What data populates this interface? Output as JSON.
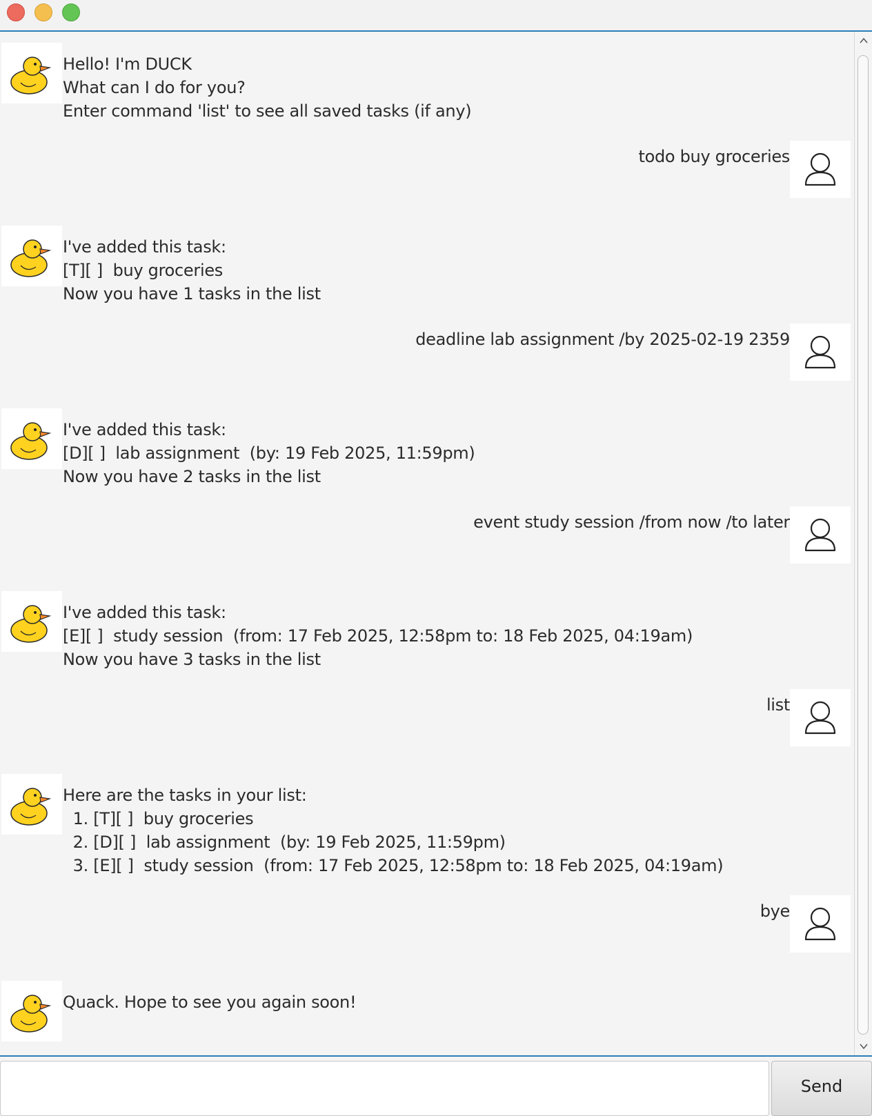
{
  "window": {
    "controls": [
      "close",
      "minimize",
      "zoom"
    ]
  },
  "messages": [
    {
      "sender": "bot",
      "avatar_icon": "duck-icon",
      "text": "Hello! I'm DUCK\nWhat can I do for you?\nEnter command 'list' to see all saved tasks (if any)"
    },
    {
      "sender": "user",
      "avatar_icon": "user-icon",
      "text": "todo buy groceries"
    },
    {
      "sender": "bot",
      "avatar_icon": "duck-icon",
      "text": "I've added this task:\n[T][ ]  buy groceries\nNow you have 1 tasks in the list"
    },
    {
      "sender": "user",
      "avatar_icon": "user-icon",
      "text": "deadline lab assignment /by 2025-02-19 2359"
    },
    {
      "sender": "bot",
      "avatar_icon": "duck-icon",
      "text": "I've added this task:\n[D][ ]  lab assignment  (by: 19 Feb 2025, 11:59pm)\nNow you have 2 tasks in the list"
    },
    {
      "sender": "user",
      "avatar_icon": "user-icon",
      "text": "event study session /from now /to later"
    },
    {
      "sender": "bot",
      "avatar_icon": "duck-icon",
      "text": "I've added this task:\n[E][ ]  study session  (from: 17 Feb 2025, 12:58pm to: 18 Feb 2025, 04:19am)\nNow you have 3 tasks in the list"
    },
    {
      "sender": "user",
      "avatar_icon": "user-icon",
      "text": "list"
    },
    {
      "sender": "bot",
      "avatar_icon": "duck-icon",
      "text": "Here are the tasks in your list:\n  1. [T][ ]  buy groceries\n  2. [D][ ]  lab assignment  (by: 19 Feb 2025, 11:59pm)\n  3. [E][ ]  study session  (from: 17 Feb 2025, 12:58pm to: 18 Feb 2025, 04:19am)"
    },
    {
      "sender": "user",
      "avatar_icon": "user-icon",
      "text": "bye"
    },
    {
      "sender": "bot",
      "avatar_icon": "duck-icon",
      "text": "Quack. Hope to see you again soon!"
    }
  ],
  "input": {
    "value": "",
    "placeholder": ""
  },
  "send_button": {
    "label": "Send"
  },
  "colors": {
    "accent": "#2a7fb8",
    "background": "#f4f4f4",
    "duck_body": "#ffd21f",
    "duck_beak": "#ff8a2a"
  }
}
